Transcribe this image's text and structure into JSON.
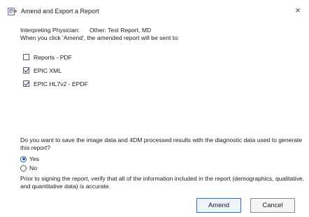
{
  "window": {
    "title": "Amend and Export a Report",
    "close_glyph": "×",
    "icon": "report-app-icon"
  },
  "physician": {
    "label": "Interpreting Physician:",
    "value": "Other: Test Report, MD"
  },
  "destination_text": "When you click 'Amend', the amended report will be sent to:",
  "destinations": [
    {
      "label": "Reports - PDF",
      "checked": false
    },
    {
      "label": "EPIC XML",
      "checked": true
    },
    {
      "label": "EPIC HL7v2 - EPDF",
      "checked": true
    }
  ],
  "save_question": "Do you want to save the image data and 4DM processed results with the diagnostic data used to generate this report?",
  "save_options": [
    {
      "label": "Yes",
      "selected": true
    },
    {
      "label": "No",
      "selected": false
    }
  ],
  "notice": "Prior to signing the report, verify that all of the information included in the report (demographics, qualitative, and quantitative data) is accurate.",
  "buttons": {
    "amend": "Amend",
    "cancel": "Cancel"
  },
  "colors": {
    "accent": "#2a6fcf",
    "check": "#1f2b6e"
  }
}
